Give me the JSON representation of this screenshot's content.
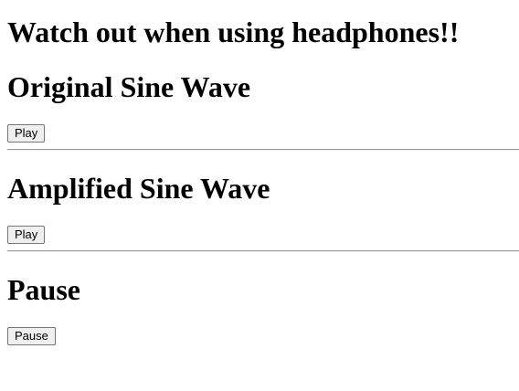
{
  "header": {
    "title": "Watch out when using headphones!!"
  },
  "sections": [
    {
      "heading": "Original Sine Wave",
      "button_label": "Play"
    },
    {
      "heading": "Amplified Sine Wave",
      "button_label": "Play"
    },
    {
      "heading": "Pause",
      "button_label": "Pause"
    }
  ]
}
